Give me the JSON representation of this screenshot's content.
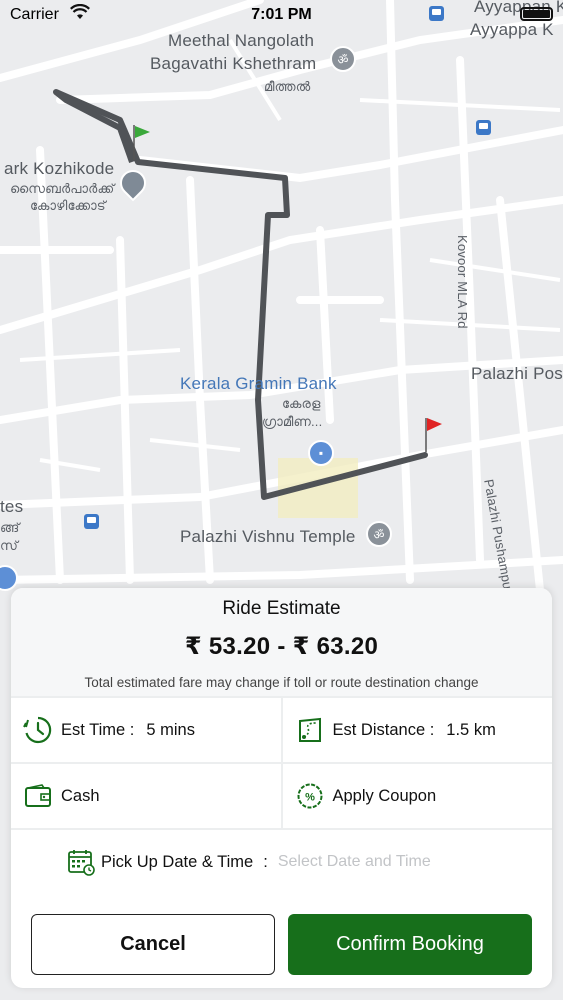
{
  "status_bar": {
    "carrier": "Carrier",
    "time": "7:01 PM"
  },
  "map": {
    "labels": {
      "meethal": "Meethal Nangolath",
      "bagavathi": "Bagavathi Kshethram",
      "meethal_ml": "മീത്തൽ",
      "cyberpark": "ark Kozhikode",
      "cyberpark_ml1": "സൈബർപാർക്ക്",
      "cyberpark_ml2": "കോഴിക്കോട്",
      "kovoor": "Kovoor MLA Rd",
      "ayyappan1": "Ayyappan K",
      "ayyappan2": "Ayyappa K",
      "kerala_bank": "Kerala Gramin Bank",
      "kerala_ml1": "കേരള",
      "kerala_ml2": "ഗ്രാമീണ...",
      "palazhi_post": "Palazhi Pos",
      "palazhi_temple": "Palazhi Vishnu Temple",
      "pushampura": "Palazhi Pushampura Road",
      "tes": "tes",
      "tes_ml1": "ങ്ങ്",
      "tes_ml2": "സ്"
    },
    "colors": {
      "route": "#505357",
      "start_flag": "#3aa83a",
      "end_flag": "#e02424"
    }
  },
  "sheet": {
    "title": "Ride Estimate",
    "fare": "₹ 53.20 - ₹ 63.20",
    "note": "Total estimated fare may change if toll or route destination change",
    "est_time_label": "Est Time :",
    "est_time_value": "5 mins",
    "est_distance_label": "Est Distance :",
    "est_distance_value": "1.5 km",
    "payment": "Cash",
    "coupon": "Apply Coupon",
    "pickup_label": "Pick Up Date & Time",
    "pickup_sep": ":",
    "pickup_placeholder": "Select Date and Time",
    "cancel": "Cancel",
    "confirm": "Confirm Booking",
    "accent": "#176f1b"
  }
}
